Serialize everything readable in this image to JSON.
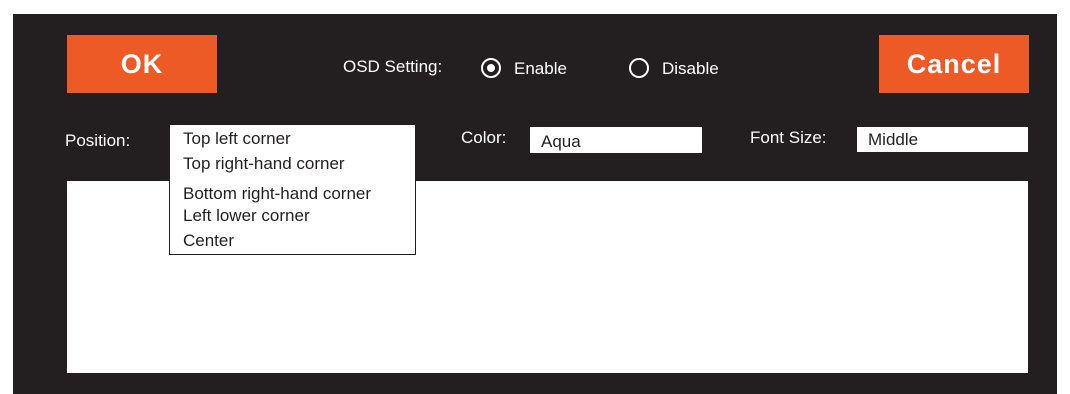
{
  "buttons": {
    "ok_label": "OK",
    "cancel_label": "Cancel"
  },
  "osd": {
    "label": "OSD Setting:",
    "options": [
      "Enable",
      "Disable"
    ],
    "selected": "Enable"
  },
  "position": {
    "label": "Position:",
    "options": [
      "Top left corner",
      "Top right-hand corner",
      "Bottom right-hand corner",
      "Left lower corner",
      "Center"
    ]
  },
  "color": {
    "label": "Color:",
    "value": "Aqua"
  },
  "font_size": {
    "label": "Font Size:",
    "value": "Middle"
  },
  "colors": {
    "panel": "#231f20",
    "accent": "#ee5a26",
    "field": "#ffffff"
  }
}
